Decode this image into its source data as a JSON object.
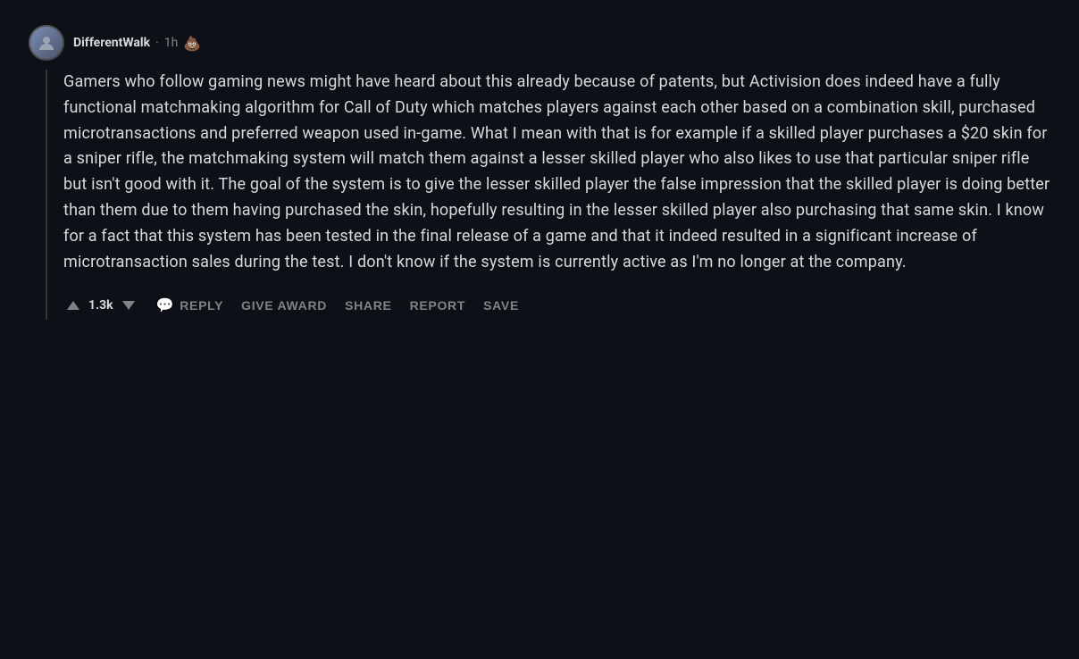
{
  "comment": {
    "username": "DifferentWalk",
    "timestamp": "1h",
    "emoji": "💩",
    "body": "Gamers who follow gaming news might have heard about this already because of patents, but Activision does indeed have a fully functional matchmaking algorithm for Call of Duty which matches players against each other based on a combination skill, purchased microtransactions and preferred weapon used in-game. What I mean with that is for example if a skilled player purchases a $20 skin for a sniper rifle, the matchmaking system will match them against a lesser skilled player who also likes to use that particular sniper rifle but isn't good with it. The goal of the system is to give the lesser skilled player the false impression that the skilled player is doing better than them due to them having purchased the skin, hopefully resulting in the lesser skilled player also purchasing that same skin. I know for a fact that this system has been tested in the final release of a game and that it indeed resulted in a significant increase of microtransaction sales during the test. I don't know if the system is currently active as I'm no longer at the company.",
    "vote_count": "1.3k",
    "actions": {
      "reply_label": "Reply",
      "give_award_label": "Give Award",
      "share_label": "Share",
      "report_label": "Report",
      "save_label": "Save"
    }
  }
}
